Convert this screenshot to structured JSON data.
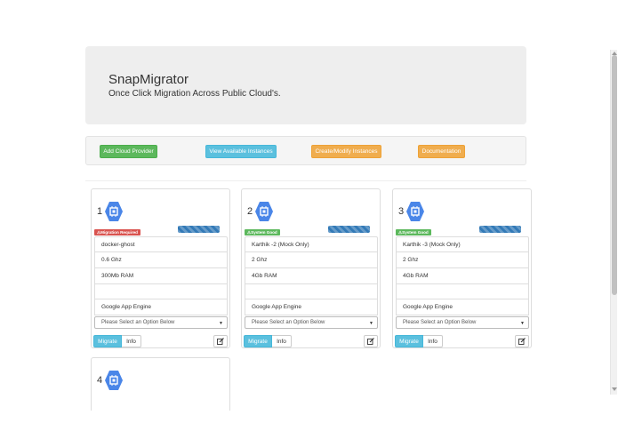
{
  "header": {
    "title": "SnapMigrator",
    "tagline": "Once Click Migration Across Public Cloud's."
  },
  "toolbar": {
    "add_cloud": "Add Cloud Provider",
    "view_instances": "View Available Instances",
    "create_modify": "Create/Modify Instances",
    "documentation": "Documentation"
  },
  "colors": {
    "green": "#5cb85c",
    "blue": "#5bc0de",
    "orange": "#f0ad4e",
    "red": "#d9534f",
    "hex_icon": "#4a86e8",
    "progress": "#337ab7"
  },
  "cards": [
    {
      "number": "1",
      "icon": "compute-engine-icon",
      "badge": "Migration Required",
      "badge_icon": "warning-icon",
      "name": "docker-ghost",
      "cpu": "0.6 Ghz",
      "ram": "300Mb RAM",
      "extra": "",
      "provider": "Google App Engine",
      "select_placeholder": "Please Select an Option Below",
      "migrate_label": "Migrate",
      "info_label": "Info"
    },
    {
      "number": "2",
      "icon": "compute-engine-icon",
      "badge": "System Good",
      "badge_icon": "warning-icon",
      "name": "Karthik -2 (Mock Only)",
      "cpu": "2 Ghz",
      "ram": "4Gb RAM",
      "extra": "",
      "provider": "Google App Engine",
      "select_placeholder": "Please Select an Option Below",
      "migrate_label": "Migrate",
      "info_label": "Info"
    },
    {
      "number": "3",
      "icon": "compute-engine-icon",
      "badge": "System Good",
      "badge_icon": "warning-icon",
      "name": "Karthik -3 (Mock Only)",
      "cpu": "2 Ghz",
      "ram": "4Gb RAM",
      "extra": "",
      "provider": "Google App Engine",
      "select_placeholder": "Please Select an Option Below",
      "migrate_label": "Migrate",
      "info_label": "Info"
    },
    {
      "number": "4",
      "icon": "compute-engine-icon"
    }
  ]
}
